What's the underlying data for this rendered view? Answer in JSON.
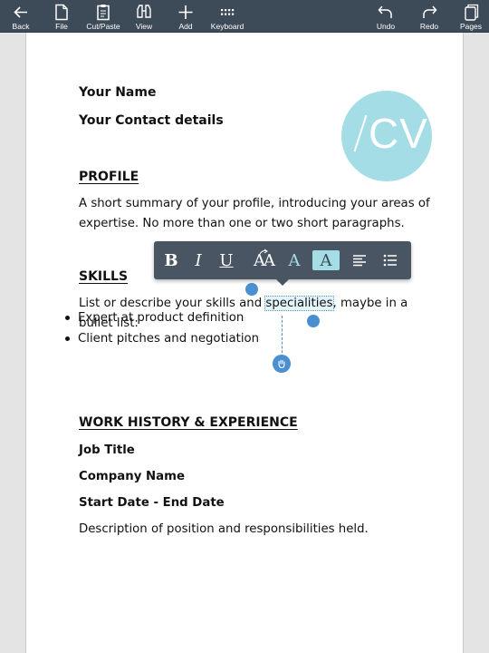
{
  "toolbar": {
    "back": "Back",
    "file": "File",
    "cutpaste": "Cut/Paste",
    "view": "View",
    "add": "Add",
    "keyboard": "Keyboard",
    "undo": "Undo",
    "redo": "Redo",
    "pages": "Pages"
  },
  "document": {
    "name": "Your Name",
    "contact": "Your Contact details",
    "logo_text": "CV",
    "profile_heading": "PROFILE",
    "profile_line1": "A short summary of your profile, introducing your areas of",
    "profile_line2": "expertise. No more than one or two short paragraphs.",
    "skills_heading": "SKILLS",
    "skills_pre": "List or describe your skills and ",
    "skills_selected": "specialities",
    "skills_post": ", maybe in a",
    "skills_line2": "bullet list:",
    "bullets": [
      "Expert at product definition",
      "Client pitches and negotiation"
    ],
    "work_heading": "WORK HISTORY & EXPERIENCE",
    "job_title": "Job Title",
    "company": "Company Name",
    "dates": "Start Date - End Date",
    "description": "Description of position and responsibilities held."
  },
  "format_popup": {
    "bold": "B",
    "italic": "I",
    "underline": "U",
    "font_size": "AA",
    "font_color": "A",
    "highlight": "A"
  },
  "colors": {
    "toolbar_bg": "#3d4a58",
    "accent": "#a4dde6",
    "handle": "#4a8fd0"
  }
}
